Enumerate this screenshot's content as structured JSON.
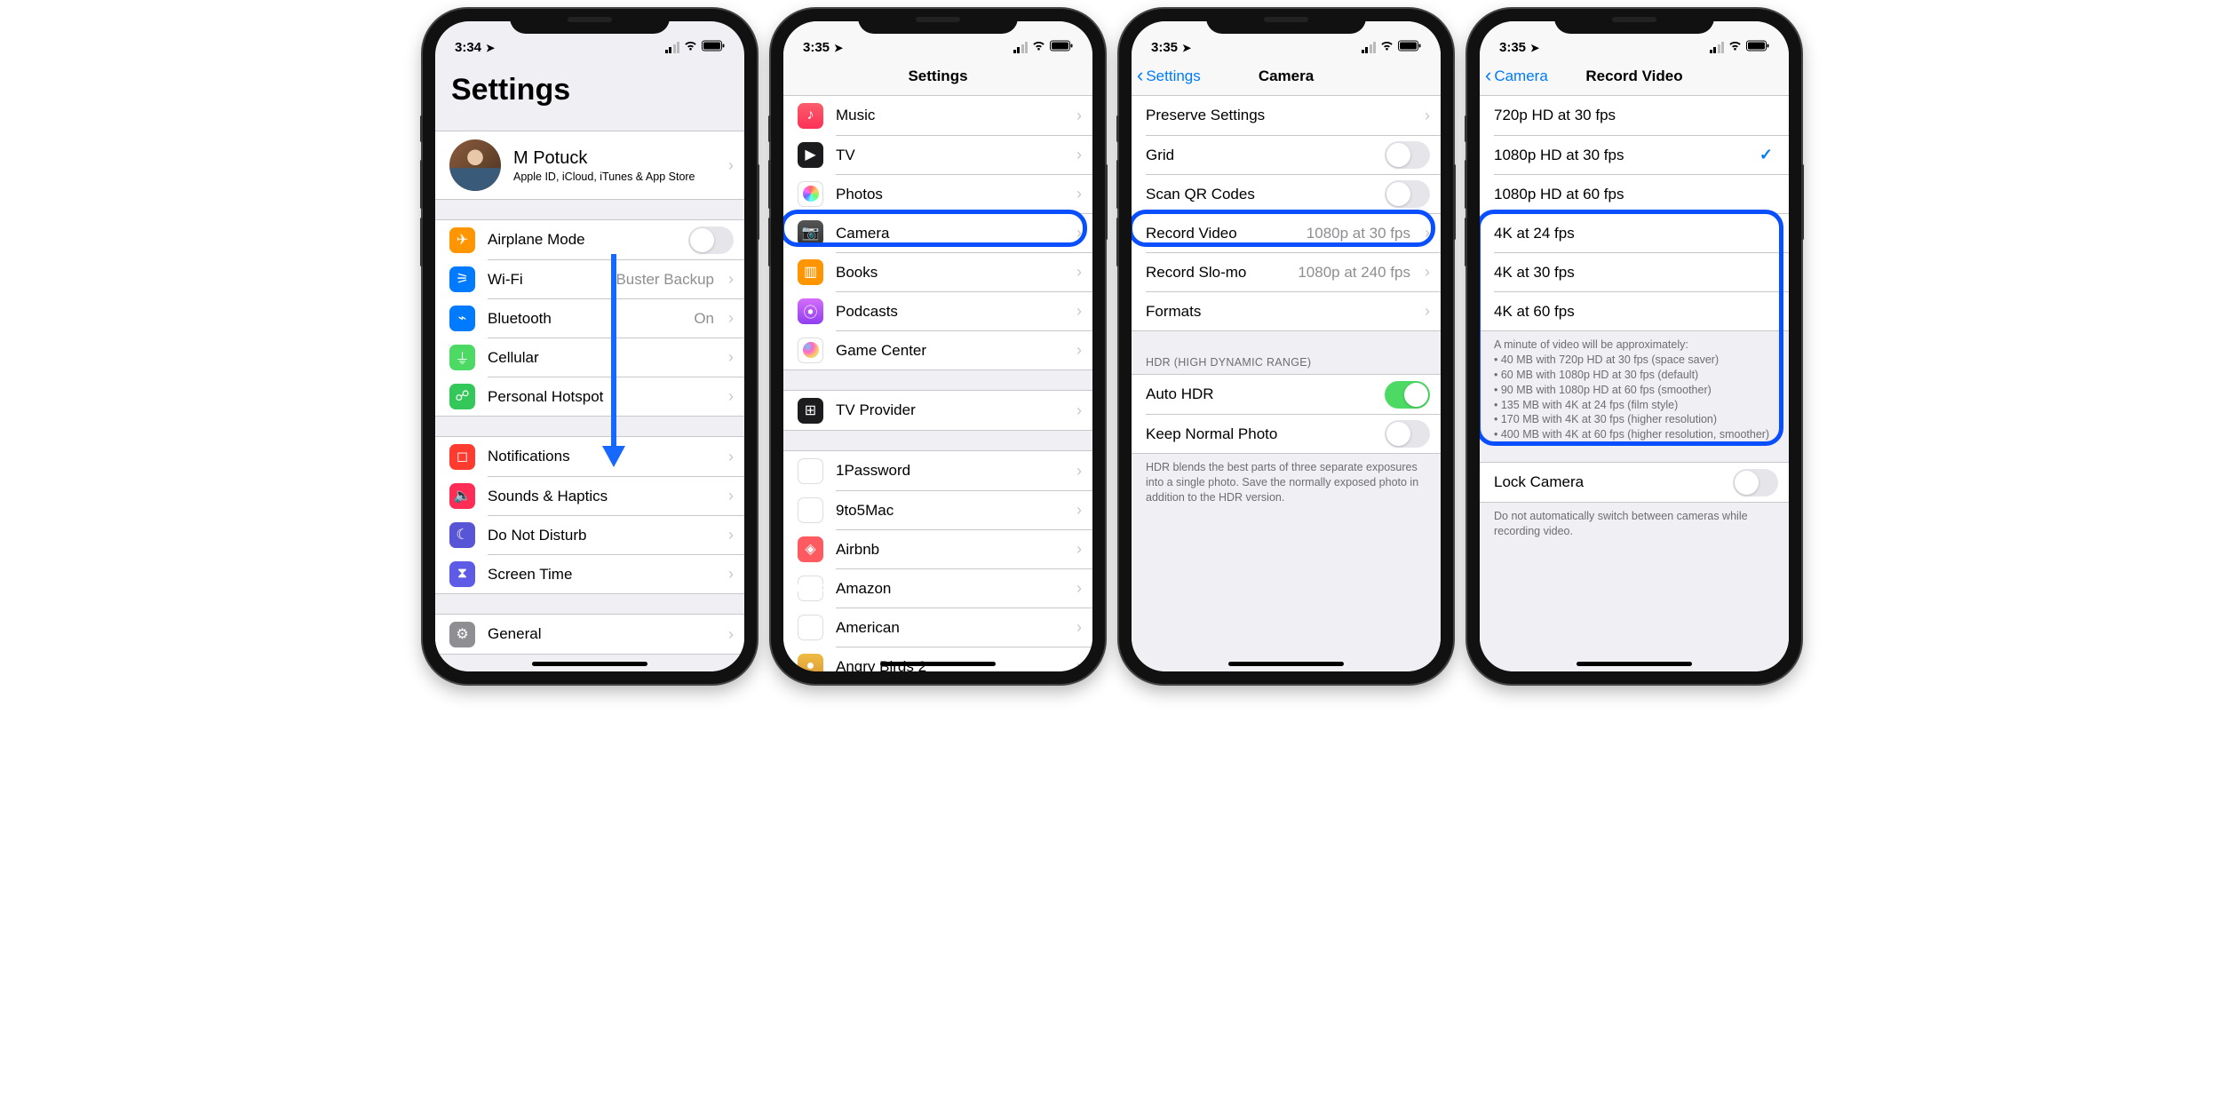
{
  "phone1": {
    "time": "3:34",
    "title": "Settings",
    "profile": {
      "name": "M Potuck",
      "sub": "Apple ID, iCloud, iTunes & App Store"
    },
    "rows1": [
      {
        "label": "Airplane Mode",
        "type": "toggle",
        "on": false,
        "icon": "airplane",
        "color": "ic-orange"
      },
      {
        "label": "Wi-Fi",
        "detail": "Buster Backup",
        "icon": "wifi",
        "color": "ic-blue"
      },
      {
        "label": "Bluetooth",
        "detail": "On",
        "icon": "bluetooth",
        "color": "ic-blue"
      },
      {
        "label": "Cellular",
        "icon": "cellular",
        "color": "ic-green"
      },
      {
        "label": "Personal Hotspot",
        "icon": "hotspot",
        "color": "ic-darkgreen"
      }
    ],
    "rows2": [
      {
        "label": "Notifications",
        "icon": "notifications",
        "color": "ic-red"
      },
      {
        "label": "Sounds & Haptics",
        "icon": "sounds",
        "color": "ic-redv"
      },
      {
        "label": "Do Not Disturb",
        "icon": "dnd",
        "color": "ic-purple"
      },
      {
        "label": "Screen Time",
        "icon": "screentime",
        "color": "ic-indigo"
      }
    ],
    "rows3": [
      {
        "label": "General",
        "icon": "general",
        "color": "ic-grey"
      }
    ]
  },
  "phone2": {
    "time": "3:35",
    "nav_title": "Settings",
    "rows1": [
      {
        "label": "Music",
        "color": "ic-music",
        "glyph": "♪"
      },
      {
        "label": "TV",
        "color": "ic-black",
        "glyph": "▶"
      },
      {
        "label": "Photos",
        "color": "ic-photos",
        "glyph": ""
      },
      {
        "label": "Camera",
        "color": "ic-camera",
        "glyph": "📷",
        "highlight": true
      },
      {
        "label": "Books",
        "color": "ic-books",
        "glyph": "▥"
      },
      {
        "label": "Podcasts",
        "color": "ic-podcasts",
        "glyph": "⦿"
      },
      {
        "label": "Game Center",
        "color": "ic-gamecenter",
        "glyph": ""
      }
    ],
    "rows2": [
      {
        "label": "TV Provider",
        "color": "ic-tvprov",
        "glyph": "⊞"
      }
    ],
    "rows3": [
      {
        "label": "1Password",
        "color": "ic-1pw",
        "glyph": "◎"
      },
      {
        "label": "9to5Mac",
        "color": "ic-9to5",
        "glyph": "⏱"
      },
      {
        "label": "Airbnb",
        "color": "ic-airbnb",
        "glyph": "◈"
      },
      {
        "label": "Amazon",
        "color": "ic-amazon",
        "glyph": "amazon"
      },
      {
        "label": "American",
        "color": "ic-american",
        "glyph": "✈"
      },
      {
        "label": "Angry Birds 2",
        "color": "ic-angry",
        "glyph": "●"
      }
    ]
  },
  "phone3": {
    "time": "3:35",
    "back": "Settings",
    "nav_title": "Camera",
    "rows1": [
      {
        "label": "Preserve Settings",
        "type": "disclosure"
      },
      {
        "label": "Grid",
        "type": "toggle",
        "on": false
      },
      {
        "label": "Scan QR Codes",
        "type": "toggle",
        "on": false
      },
      {
        "label": "Record Video",
        "detail": "1080p at 30 fps",
        "type": "disclosure",
        "highlight": true
      },
      {
        "label": "Record Slo-mo",
        "detail": "1080p at 240 fps",
        "type": "disclosure"
      },
      {
        "label": "Formats",
        "type": "disclosure"
      }
    ],
    "hdr_header": "HDR (HIGH DYNAMIC RANGE)",
    "rows2": [
      {
        "label": "Auto HDR",
        "type": "toggle",
        "on": true
      },
      {
        "label": "Keep Normal Photo",
        "type": "toggle",
        "on": false
      }
    ],
    "hdr_footer": "HDR blends the best parts of three separate exposures into a single photo. Save the normally exposed photo in addition to the HDR version."
  },
  "phone4": {
    "time": "3:35",
    "back": "Camera",
    "nav_title": "Record Video",
    "options": [
      {
        "label": "720p HD at 30 fps",
        "checked": false
      },
      {
        "label": "1080p HD at 30 fps",
        "checked": true
      },
      {
        "label": "1080p HD at 60 fps",
        "checked": false
      },
      {
        "label": "4K at 24 fps",
        "checked": false
      },
      {
        "label": "4K at 30 fps",
        "checked": false
      },
      {
        "label": "4K at 60 fps",
        "checked": false
      }
    ],
    "footer_intro": "A minute of video will be approximately:",
    "footer_lines": [
      "40 MB with 720p HD at 30 fps (space saver)",
      "60 MB with 1080p HD at 30 fps (default)",
      "90 MB with 1080p HD at 60 fps (smoother)",
      "135 MB with 4K at 24 fps (film style)",
      "170 MB with 4K at 30 fps (higher resolution)",
      "400 MB with 4K at 60 fps (higher resolution, smoother)"
    ],
    "lock_label": "Lock Camera",
    "lock_footer": "Do not automatically switch between cameras while recording video."
  }
}
